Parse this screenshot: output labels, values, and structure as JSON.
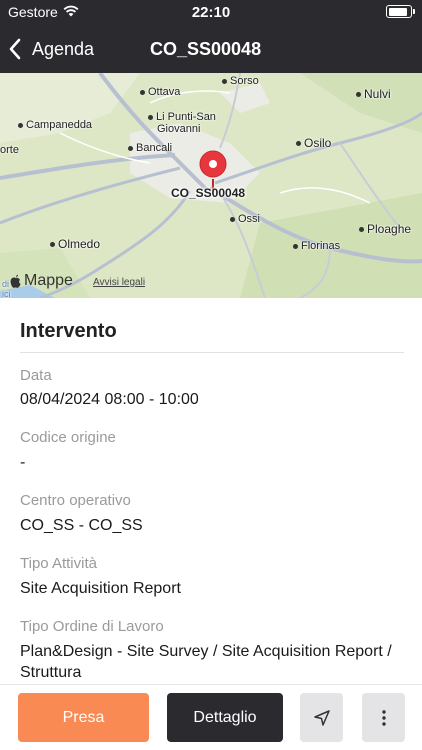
{
  "status_bar": {
    "carrier": "Gestore",
    "time": "22:10",
    "battery_level": 0.92
  },
  "nav": {
    "back_label": "Agenda",
    "title": "CO_SS00048"
  },
  "map": {
    "places": [
      "Sorso",
      "Ottava",
      "Nulvi",
      "Li Punti-San",
      "Giovanni",
      "Campanedda",
      "Osilo",
      "orte",
      "Bancali",
      "Ossi",
      "Olmedo",
      "Florinas",
      "Ploaghe"
    ],
    "pin_label": "CO_SS00048",
    "brand": "Mappe",
    "legal": "Avvisi legali",
    "edge_text": "di",
    "edge_text2": "ici"
  },
  "section": {
    "title": "Intervento"
  },
  "fields": [
    {
      "label": "Data",
      "value": "08/04/2024 08:00 - 10:00"
    },
    {
      "label": "Codice origine",
      "value": "-"
    },
    {
      "label": "Centro operativo",
      "value": "CO_SS - CO_SS"
    },
    {
      "label": "Tipo Attività",
      "value": "Site Acquisition Report"
    },
    {
      "label": "Tipo Ordine di Lavoro",
      "value": "Plan&Design - Site Survey / Site Acquisition Report / Struttura"
    }
  ],
  "actions": {
    "presa": "Presa",
    "dettaglio": "Dettaglio"
  },
  "colors": {
    "header": "#2b2b2f",
    "accent": "#f98a54",
    "pin": "#e8363d"
  }
}
